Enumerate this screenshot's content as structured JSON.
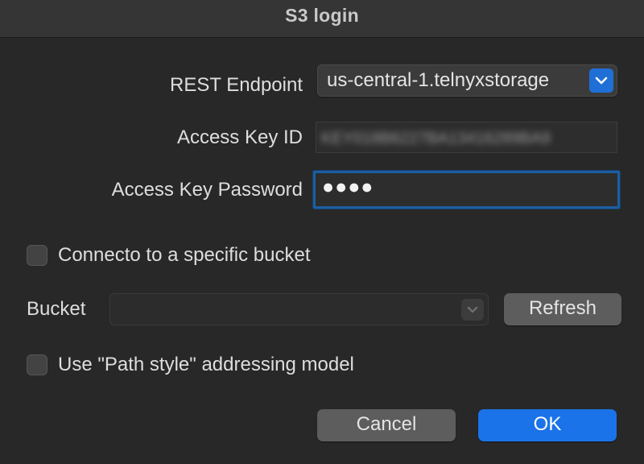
{
  "window": {
    "title": "S3 login"
  },
  "form": {
    "endpoint_label": "REST Endpoint",
    "endpoint_value": "us-central-1.telnyxstorage",
    "access_key_id_label": "Access Key ID",
    "access_key_id_value": "KEY018B6227BA13416289BA9",
    "password_label": "Access Key Password",
    "password_value": "●●●●",
    "specific_bucket_label": "Connecto to a specific bucket",
    "specific_bucket_checked": false,
    "bucket_label": "Bucket",
    "bucket_value": "",
    "refresh_label": "Refresh",
    "path_style_label": "Use \"Path style\" addressing model",
    "path_style_checked": false
  },
  "buttons": {
    "cancel_label": "Cancel",
    "ok_label": "OK"
  },
  "colors": {
    "accent": "#1a73e8",
    "focus_ring": "#1d5ea0",
    "background": "#282828"
  },
  "icons": {
    "endpoint_dropdown": "chevron-down-icon",
    "bucket_dropdown": "chevron-down-icon"
  }
}
